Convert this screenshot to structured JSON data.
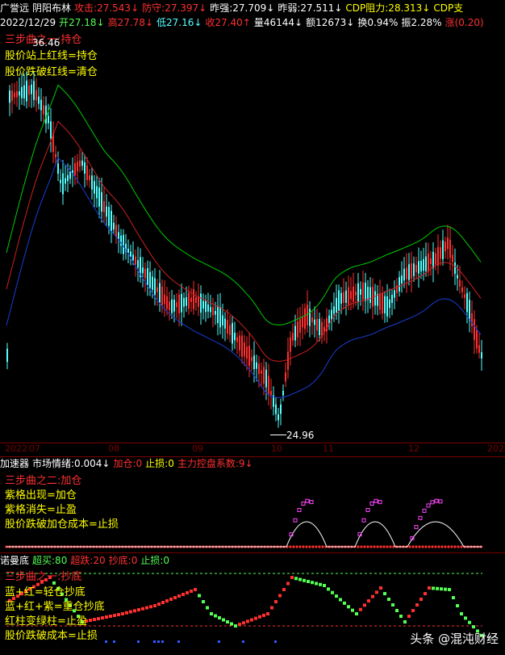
{
  "main": {
    "header1": [
      {
        "text": "广誉远",
        "color": "#ffffff"
      },
      {
        "text": "阴阳布林",
        "color": "#ffffff"
      },
      {
        "text": "攻击:27.543↓",
        "color": "#ff3030"
      },
      {
        "text": "防守:27.397↓",
        "color": "#ff3030"
      },
      {
        "text": "昨强:27.709↓",
        "color": "#ffffff"
      },
      {
        "text": "昨弱:27.511↓",
        "color": "#ffffff"
      },
      {
        "text": "CDP阻力:28.313↓",
        "color": "#ffff00"
      },
      {
        "text": "CDP支",
        "color": "#ffff00"
      }
    ],
    "header2": [
      {
        "text": "2022/12/29",
        "color": "#ffffff"
      },
      {
        "text": "开27.18↓",
        "color": "#55ff55"
      },
      {
        "text": "高27.78↓",
        "color": "#ff3030"
      },
      {
        "text": "低27.16↓",
        "color": "#55ffff"
      },
      {
        "text": "收27.40↑",
        "color": "#ff3030"
      },
      {
        "text": "量46144↓",
        "color": "#ffffff"
      },
      {
        "text": "额12673↓",
        "color": "#ffffff"
      },
      {
        "text": "换0.94%",
        "color": "#ffffff"
      },
      {
        "text": "振2.28%",
        "color": "#ffffff"
      },
      {
        "text": "涨(0.20)",
        "color": "#ff3030"
      }
    ],
    "overlay_title": "三步曲之一:持仓",
    "notes": [
      "股价站上红线=持仓",
      "股价跌破红线=清仓"
    ],
    "high_label": "36.46",
    "low_label": "24.96"
  },
  "time_axis": {
    "labels": [
      "2022",
      "07",
      "08",
      "09",
      "10",
      "11",
      "12",
      "202"
    ]
  },
  "indicator1": {
    "header": [
      {
        "text": "加速器",
        "color": "#ffffff"
      },
      {
        "text": "市场情绪:0.004↓",
        "color": "#ffffff"
      },
      {
        "text": "加仓:0",
        "color": "#ff3030"
      },
      {
        "text": "止损:0",
        "color": "#ffff00"
      },
      {
        "text": "主力控盘系数:9↓",
        "color": "#ff3030"
      }
    ],
    "overlay_title": "三步曲之二:加仓",
    "notes": [
      "紫格出现=加仓",
      "紫格消失=止盈",
      "股价跌破加仓成本=止损"
    ]
  },
  "indicator2": {
    "header": [
      {
        "text": "诺曼底",
        "color": "#ffffff"
      },
      {
        "text": "超买:80",
        "color": "#55ff55"
      },
      {
        "text": "超跌:20",
        "color": "#ff3030"
      },
      {
        "text": "抄底:0",
        "color": "#ff3030"
      },
      {
        "text": "止损:0",
        "color": "#55ff55"
      }
    ],
    "overlay_title": "三步曲之一:抄底",
    "notes": [
      "蓝+红=轻仓抄底",
      "蓝+红+紫=重仓抄底",
      "红柱变绿柱=止盈",
      "股价跌破成本=止损"
    ]
  },
  "watermark": "头条 @混沌财经",
  "colors": {
    "up": "#ff3030",
    "down": "#55ffff",
    "green_line": "#00cc00",
    "red_line": "#cc2020",
    "blue_line": "#1a3dd6",
    "purple": "#ff44ff"
  }
}
